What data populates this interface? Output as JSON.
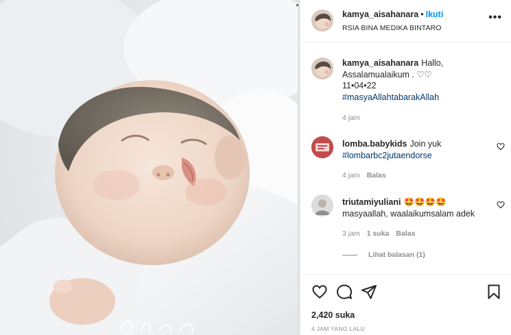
{
  "post": {
    "author": "kamya_aisahanara",
    "separator": "•",
    "follow_label": "Ikuti",
    "location": "RSIA BINA MEDIKA BINTARO",
    "more_label": "•••"
  },
  "caption": {
    "username": "kamya_aisahanara",
    "line1": "Hallo,",
    "line2": "Assalamualaikum . ♡♡",
    "line3": "11•04•22",
    "hashtag": "#masyaAllahtabarakAllah",
    "time": "4 jam"
  },
  "comments": [
    {
      "username": "lomba.babykids",
      "text": "Join yuk",
      "hashtag": "#lombarbc2jutaendorse",
      "time": "4 jam",
      "reply_label": "Balas"
    },
    {
      "username": "triutamiyuliani",
      "emoji": "🤩🤩🤩🤩",
      "text": "masyaallah, waalaikumsalam adek",
      "time": "3 jam",
      "likes": "1 suka",
      "reply_label": "Balas"
    }
  ],
  "view_replies": "Lihat balasan (1)",
  "actions": {
    "like_icon": "heart-icon",
    "comment_icon": "comment-icon",
    "share_icon": "send-icon",
    "save_icon": "bookmark-icon"
  },
  "likes_count": "2,420 suka",
  "posted_ago": "4 JAM YANG LALU",
  "colors": {
    "accent": "#0095f6",
    "hashtag": "#00376b",
    "muted": "#8e8e8e"
  }
}
